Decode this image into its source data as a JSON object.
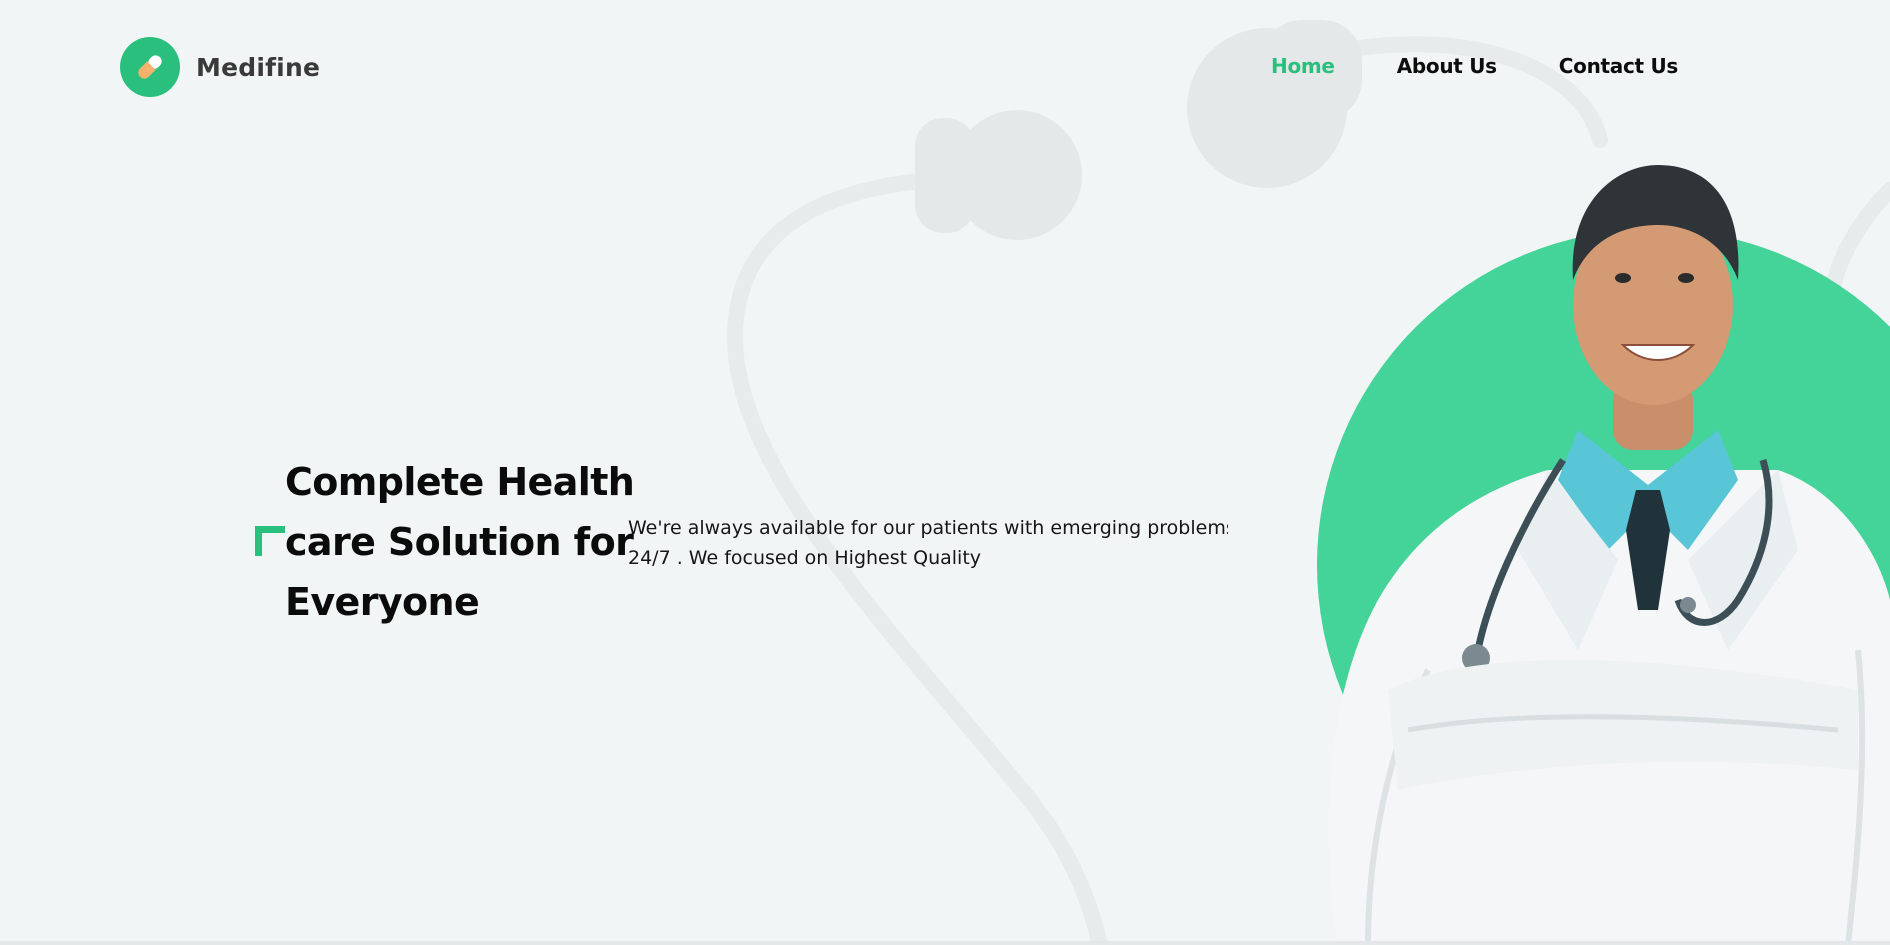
{
  "brand": {
    "name": "Medifine",
    "icon": "pill-icon",
    "accent_color": "#2bbf7e",
    "hero_circle_color": "#44d398"
  },
  "nav": {
    "items": [
      {
        "label": "Home",
        "active": true
      },
      {
        "label": "About Us",
        "active": false
      },
      {
        "label": "Contact Us",
        "active": false
      }
    ]
  },
  "hero": {
    "heading_lines": [
      "Complete Health",
      "care Solution for",
      "Everyone"
    ],
    "description_lines": [
      "We're always available for our patients with emerging problems",
      "24/7 . We focused on Highest Quality"
    ],
    "image": "doctor-portrait"
  }
}
